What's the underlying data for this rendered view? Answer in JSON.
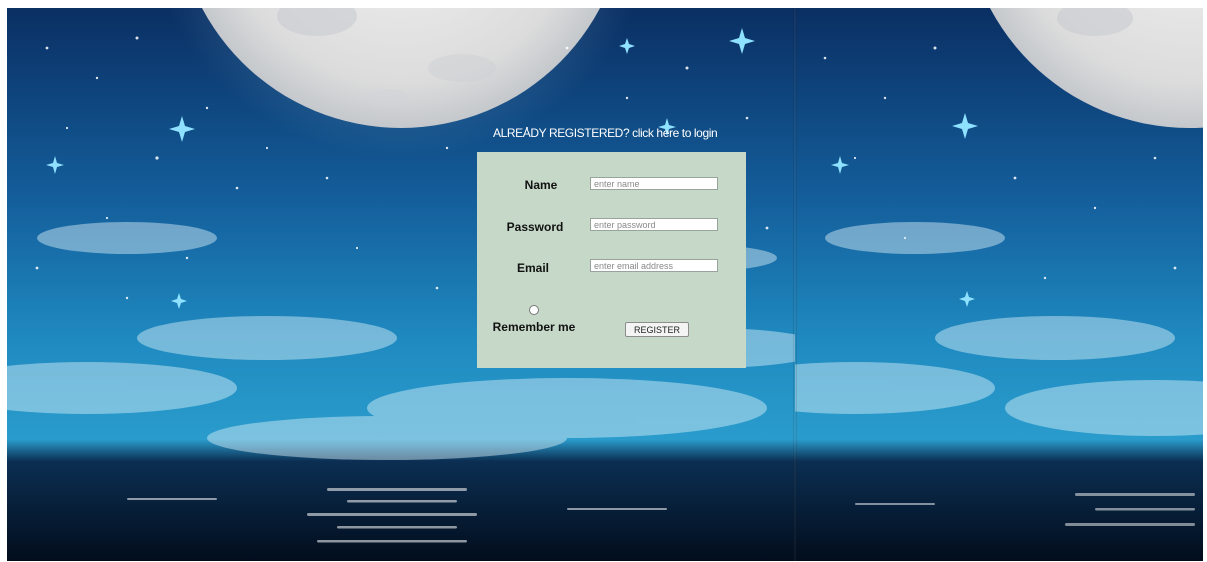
{
  "login_prompt": {
    "text": "ALREADY REGISTERED? click here to login"
  },
  "form": {
    "name_label": "Name",
    "name_placeholder": "enter name",
    "password_label": "Password",
    "password_placeholder": "enter password",
    "email_label": "Email",
    "email_placeholder": "enter email address",
    "remember_label": "Remember me",
    "register_label": "REGISTER"
  },
  "colors": {
    "form_background": "#c6d9c8",
    "sky_top": "#0b3d78",
    "sky_mid": "#1b7fb8",
    "water": "#04162b"
  },
  "background": {
    "icon": "night-sky-moon-scene"
  }
}
